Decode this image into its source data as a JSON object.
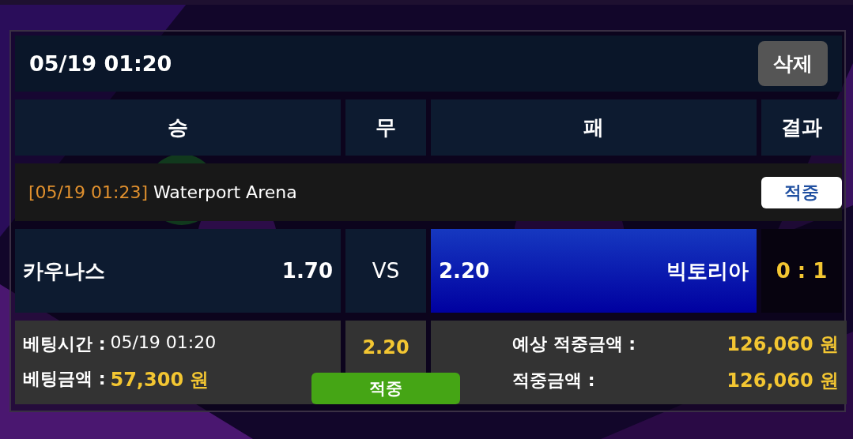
{
  "header": {
    "datetime": "05/19 01:20",
    "delete_button": "삭제"
  },
  "columns": [
    "승",
    "무",
    "패",
    "결과"
  ],
  "match_info": {
    "time": "[05/19 01:23]",
    "venue": "Waterport Arena",
    "result_badge": "적중"
  },
  "match": {
    "home": {
      "name": "카우나스",
      "odds": "1.70",
      "selected": false
    },
    "draw": "VS",
    "away": {
      "odds": "2.20",
      "name": "빅토리아",
      "selected": true
    },
    "score": "0 : 1"
  },
  "bet": {
    "time_label": "베팅시간 :",
    "time": "05/19 01:20",
    "amount_label": "베팅금액 :",
    "amount": "57,300 원",
    "odds": "2.20",
    "status": "적중",
    "expected_label": "예상 적중금액 :",
    "expected": "126,060 원",
    "won_label": "적중금액 :",
    "won": "126,060 원"
  }
}
